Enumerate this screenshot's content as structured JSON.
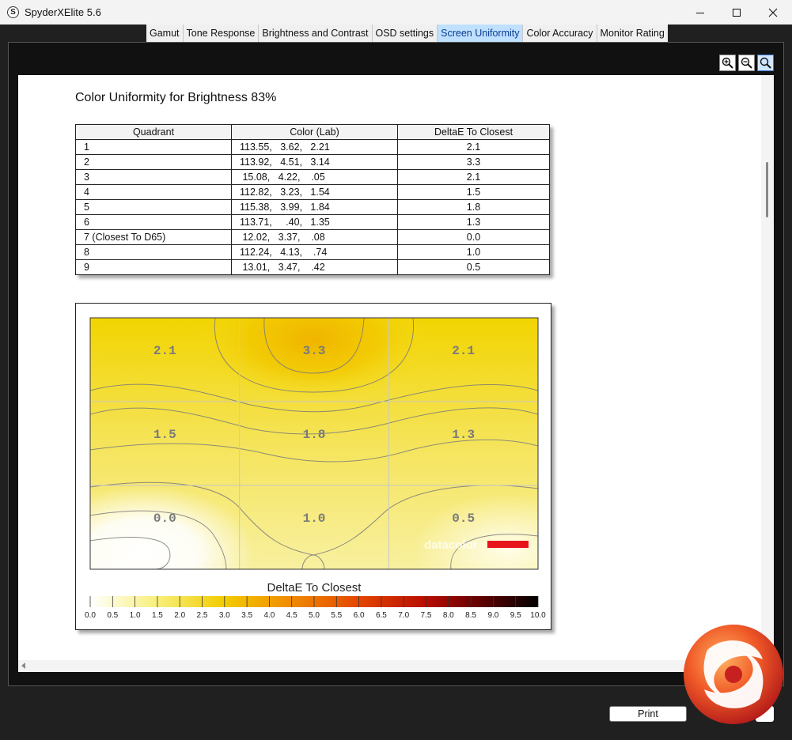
{
  "window": {
    "app_icon_letter": "S",
    "title": "SpyderXElite 5.6"
  },
  "tabs": [
    {
      "label": "Gamut",
      "active": false
    },
    {
      "label": "Tone Response",
      "active": false
    },
    {
      "label": "Brightness and Contrast",
      "active": false
    },
    {
      "label": "OSD settings",
      "active": false
    },
    {
      "label": "Screen Uniformity",
      "active": true
    },
    {
      "label": "Color Accuracy",
      "active": false
    },
    {
      "label": "Monitor Rating",
      "active": false
    }
  ],
  "toolbar": {
    "icons": [
      "zoom-in-icon",
      "zoom-out-icon",
      "zoom-fit-icon"
    ]
  },
  "report": {
    "title": "Color Uniformity for Brightness 83%",
    "table": {
      "headers": [
        "Quadrant",
        "Color (Lab)",
        "DeltaE To Closest"
      ],
      "rows": [
        [
          "1",
          "113.55,   3.62,   2.21",
          "2.1"
        ],
        [
          "2",
          "113.92,   4.51,   3.14",
          "3.3"
        ],
        [
          "3",
          " 15.08,   4.22,    .05",
          "2.1"
        ],
        [
          "4",
          "112.82,   3.23,   1.54",
          "1.5"
        ],
        [
          "5",
          "115.38,   3.99,   1.84",
          "1.8"
        ],
        [
          "6",
          "113.71,     .40,   1.35",
          "1.3"
        ],
        [
          "7 (Closest To D65)",
          " 12.02,   3.37,    .08",
          "0.0"
        ],
        [
          "8",
          "112.24,   4.13,    .74",
          "1.0"
        ],
        [
          "9",
          " 13.01,   3.47,    .42",
          "0.5"
        ]
      ]
    }
  },
  "chart_data": {
    "type": "heatmap",
    "title": "DeltaE To Closest",
    "grid": {
      "rows": 3,
      "cols": 3
    },
    "values": [
      [
        2.1,
        3.3,
        2.1
      ],
      [
        1.5,
        1.8,
        1.3
      ],
      [
        0.0,
        1.0,
        0.5
      ]
    ],
    "labels": [
      [
        "2.1",
        "3.3",
        "2.1"
      ],
      [
        "1.5",
        "1.8",
        "1.3"
      ],
      [
        "0.0",
        "1.0",
        "0.5"
      ]
    ],
    "colorbar": {
      "min": 0.0,
      "max": 10.0,
      "ticks": [
        "0.0",
        "0.5",
        "1.0",
        "1.5",
        "2.0",
        "2.5",
        "3.0",
        "3.5",
        "4.0",
        "4.5",
        "5.0",
        "5.5",
        "6.0",
        "6.5",
        "7.0",
        "7.5",
        "8.0",
        "8.5",
        "9.0",
        "9.5",
        "10.0"
      ]
    },
    "watermark": "datacolor",
    "colors": {
      "low": "#ffffff",
      "mid": "#f2d000",
      "high_orange": "#f08a00",
      "high_red": "#c01000",
      "max": "#000000"
    }
  },
  "footer": {
    "print_label": "Print"
  }
}
